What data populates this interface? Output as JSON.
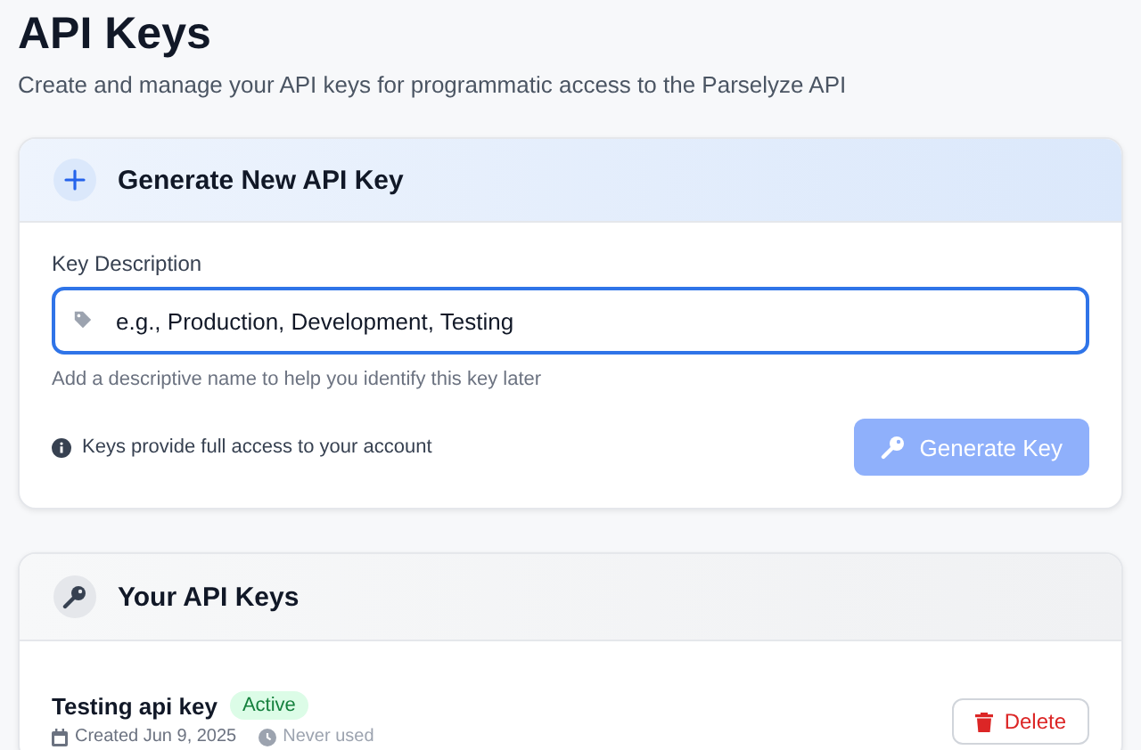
{
  "page": {
    "title": "API Keys",
    "subtitle": "Create and manage your API keys for programmatic access to the Parselyze API"
  },
  "generate_card": {
    "title": "Generate New API Key",
    "field_label": "Key Description",
    "placeholder": "e.g., Production, Development, Testing",
    "focused": true,
    "hint": "Add a descriptive name to help you identify this key later",
    "notice": "Keys provide full access to your account",
    "button": {
      "label": "Generate Key",
      "disabled": true
    }
  },
  "keys_card": {
    "title": "Your API Keys",
    "keys": [
      {
        "name": "Testing api key",
        "status": "Active",
        "active": true,
        "created": "Created Jun 9, 2025",
        "last_used": "Never used",
        "delete_label": "Delete"
      }
    ]
  }
}
